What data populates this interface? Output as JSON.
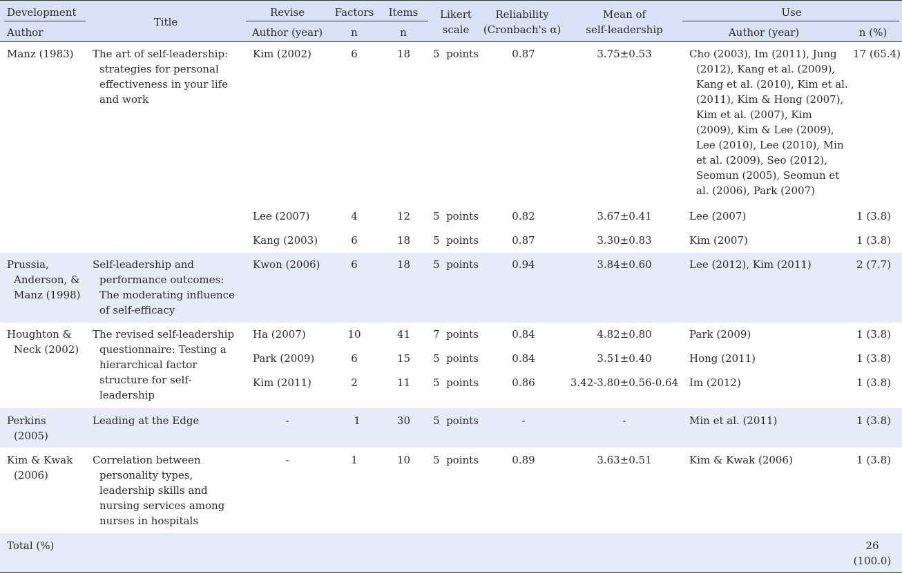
{
  "header": {
    "development": "Development",
    "author": "Author",
    "title": "Title",
    "revise": "Revise",
    "revise_author": "Author (year)",
    "factors": "Factors",
    "factors_n": "n",
    "items": "Items",
    "items_n": "n",
    "likert_1": "Likert",
    "likert_2": "scale",
    "reliability_1": "Reliability",
    "reliability_2": "(Cronbach's α)",
    "mean_1": "Mean of",
    "mean_2": "self-leadership",
    "use": "Use",
    "use_author": "Author (year)",
    "use_n": "n (%)"
  },
  "groups": [
    {
      "author": "Manz (1983)",
      "title": "The art of self-leadership: strategies for personal effectiveness in your life and work",
      "rows": [
        {
          "revise": "Kim (2002)",
          "factors": "6",
          "items": "18",
          "likert": "5  points",
          "reliability": "0.87",
          "mean": "3.75±0.53",
          "use": "Cho (2003), Im (2011), Jung (2012), Kang et al. (2009), Kang et al. (2010), Kim et al. (2011), Kim & Hong (2007), Kim et al. (2007), Kim (2009), Kim & Lee (2009), Lee (2010), Lee (2010), Min et al. (2009), Seo (2012), Seomun (2005), Seomun et al. (2006), Park (2007)",
          "n": "17 (65.4)"
        },
        {
          "revise": "Lee (2007)",
          "factors": "4",
          "items": "12",
          "likert": "5  points",
          "reliability": "0.82",
          "mean": "3.67±0.41",
          "use": "Lee (2007)",
          "n": "1 (3.8)"
        },
        {
          "revise": "Kang (2003)",
          "factors": "6",
          "items": "18",
          "likert": "5  points",
          "reliability": "0.87",
          "mean": "3.30±0.83",
          "use": "Kim (2007)",
          "n": "1 (3.8)"
        }
      ]
    },
    {
      "author": "Prussia, Anderson, & Manz (1998)",
      "title": "Self-leadership and performance outcomes: The moderating influence of self-efficacy",
      "rows": [
        {
          "revise": "Kwon (2006)",
          "factors": "6",
          "items": "18",
          "likert": "5  points",
          "reliability": "0.94",
          "mean": "3.84±0.60",
          "use": "Lee (2012), Kim (2011)",
          "n": "2 (7.7)"
        }
      ]
    },
    {
      "author": "Houghton & Neck (2002)",
      "title": "The revised self-leadership questionnaire: Testing a hierarchical factor structure for self-leadership",
      "rows": [
        {
          "revise": "Ha (2007)",
          "factors": "10",
          "items": "41",
          "likert": "7  points",
          "reliability": "0.84",
          "mean": "4.82±0.80",
          "use": "Park (2009)",
          "n": "1 (3.8)"
        },
        {
          "revise": "Park (2009)",
          "factors": "6",
          "items": "15",
          "likert": "5  points",
          "reliability": "0.84",
          "mean": "3.51±0.40",
          "use": "Hong (2011)",
          "n": "1 (3.8)"
        },
        {
          "revise": "Kim (2011)",
          "factors": "2",
          "items": "11",
          "likert": "5  points",
          "reliability": "0.86",
          "mean": "3.42-3.80±0.56-0.64",
          "use": "Im (2012)",
          "n": "1 (3.8)"
        }
      ]
    },
    {
      "author": "Perkins (2005)",
      "title": "Leading at the Edge",
      "rows": [
        {
          "revise": "-",
          "factors": "1",
          "items": "30",
          "likert": "5  points",
          "reliability": "-",
          "mean": "-",
          "use": "Min et al. (2011)",
          "n": "1 (3.8)"
        }
      ]
    },
    {
      "author": "Kim & Kwak (2006)",
      "title": "Correlation between personality types, leadership skills and nursing services among nurses in hospitals",
      "rows": [
        {
          "revise": "-",
          "factors": "1",
          "items": "10",
          "likert": "5  points",
          "reliability": "0.89",
          "mean": "3.63±0.51",
          "use": "Kim & Kwak (2006)",
          "n": "1 (3.8)"
        }
      ]
    }
  ],
  "total": {
    "label": "Total (%)",
    "n": "26 (100.0)"
  }
}
